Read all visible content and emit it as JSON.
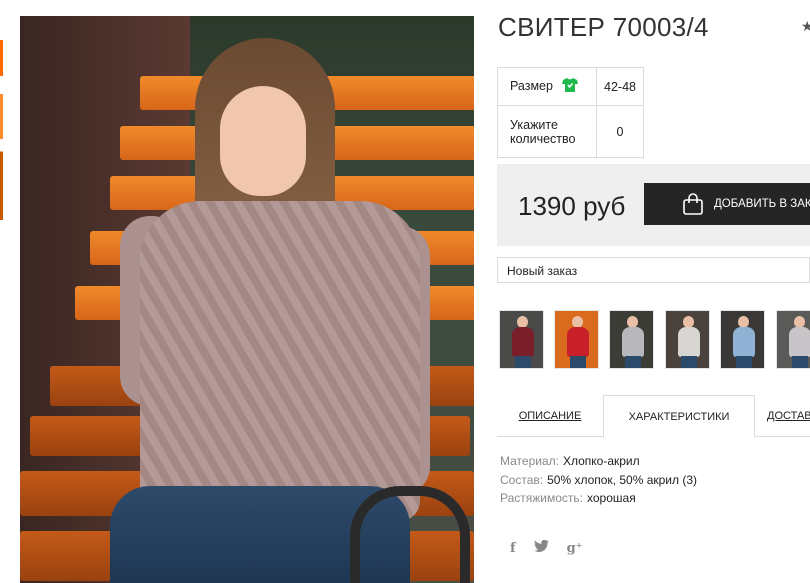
{
  "product": {
    "title": "СВИТЕР 70003/4"
  },
  "specs": [
    {
      "label": "Размер",
      "value": "42-48"
    },
    {
      "label": "Укажите количество",
      "value": "0"
    }
  ],
  "price": {
    "amount": "1390 руб",
    "add_button_label": "ДОБАВИТЬ В ЗАКАЗ"
  },
  "order": {
    "selected": "Новый заказ"
  },
  "tabs": [
    {
      "label": "ОПИСАНИЕ"
    },
    {
      "label": "ХАРАКТЕРИСТИКИ"
    },
    {
      "label": "ДОСТАВКА"
    }
  ],
  "characteristics": [
    {
      "key": "Материал:",
      "value": "Хлопко-акрил"
    },
    {
      "key": "Состав:",
      "value": "50% хлопок, 50% акрил (3)"
    },
    {
      "key": "Растяжимость:",
      "value": "хорошая"
    }
  ],
  "thumb_colors": [
    "#7a1f2a",
    "#c8202a",
    "#b8b8bc",
    "#d8d6d2",
    "#8fb2d4",
    "#c8c4c8"
  ],
  "icons": {
    "size_icon": "tshirt-icon",
    "add_icon": "shopping-bag-icon",
    "social": [
      "facebook-icon",
      "twitter-icon",
      "google-plus-icon"
    ]
  },
  "social_glyphs": {
    "facebook": "f",
    "twitter": "t",
    "gplus": "g⁺"
  }
}
